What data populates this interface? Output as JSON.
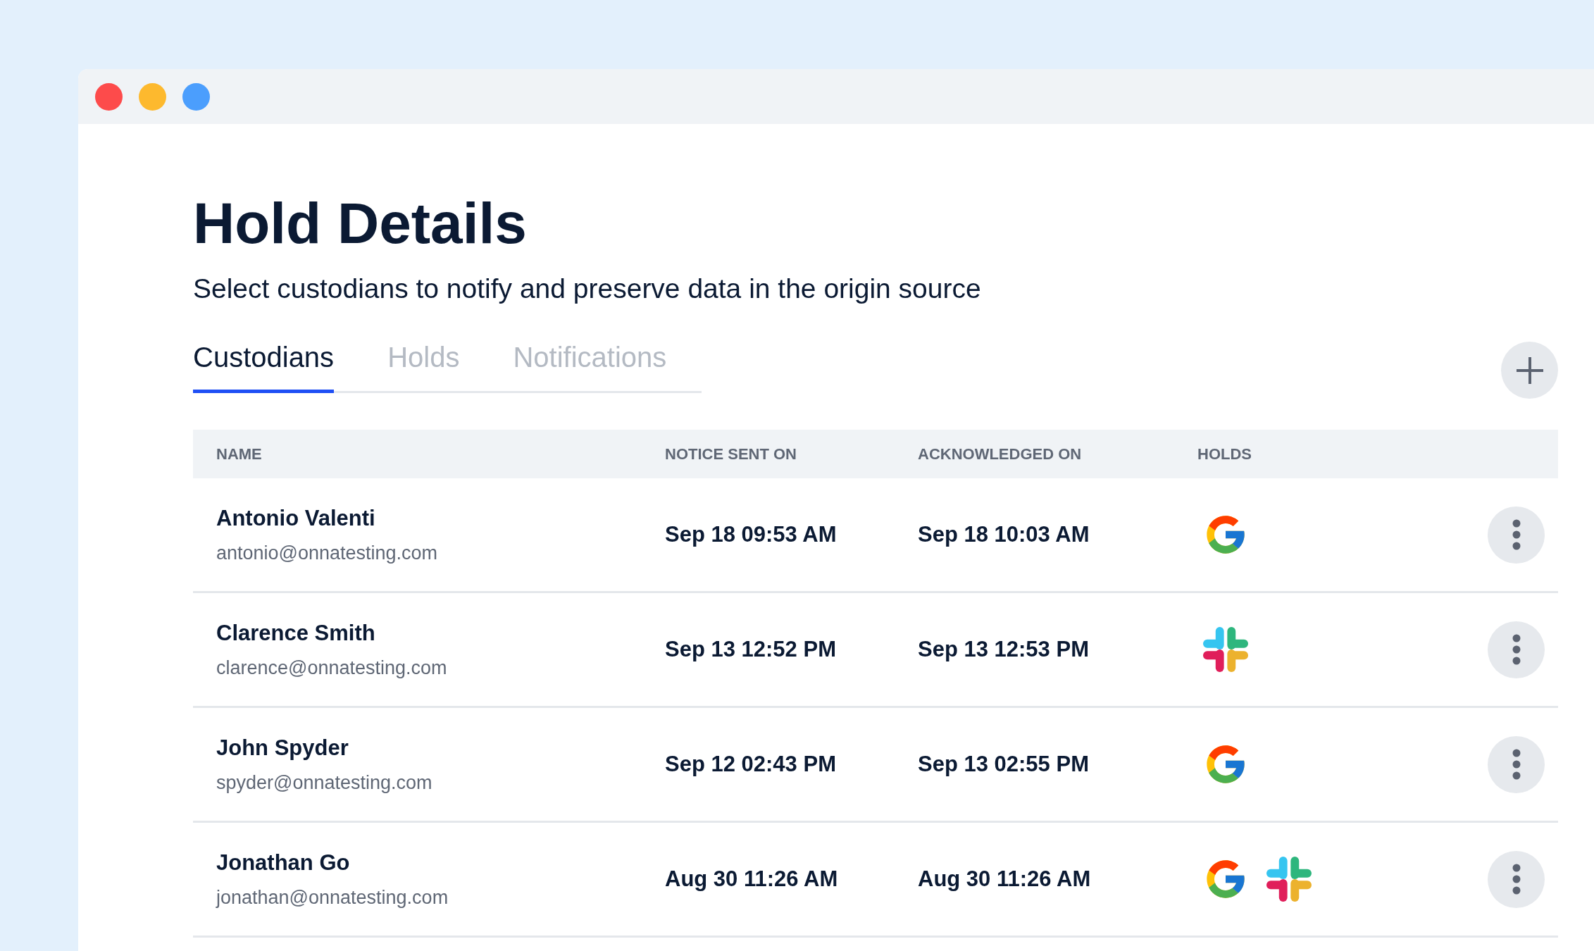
{
  "page": {
    "title": "Hold Details",
    "subtitle": "Select custodians to notify and preserve data in the origin source"
  },
  "tabs": [
    {
      "label": "Custodians",
      "selected": true
    },
    {
      "label": "Holds",
      "selected": false
    },
    {
      "label": "Notifications",
      "selected": false
    }
  ],
  "table": {
    "columns": [
      "NAME",
      "NOTICE SENT ON",
      "ACKNOWLEDGED ON",
      "HOLDS"
    ],
    "rows": [
      {
        "name": "Antonio Valenti",
        "email": "antonio@onnatesting.com",
        "notice_sent_on": "Sep 18 09:53 AM",
        "acknowledged_on": "Sep 18 10:03 AM",
        "holds": [
          {
            "kind": "google"
          }
        ]
      },
      {
        "name": "Clarence Smith",
        "email": "clarence@onnatesting.com",
        "notice_sent_on": "Sep 13 12:52 PM",
        "acknowledged_on": "Sep 13 12:53 PM",
        "holds": [
          {
            "kind": "slack"
          }
        ]
      },
      {
        "name": "John Spyder",
        "email": "spyder@onnatesting.com",
        "notice_sent_on": "Sep 12 02:43 PM",
        "acknowledged_on": "Sep 13 02:55 PM",
        "holds": [
          {
            "kind": "google"
          }
        ]
      },
      {
        "name": "Jonathan Go",
        "email": "jonathan@onnatesting.com",
        "notice_sent_on": "Aug 30 11:26 AM",
        "acknowledged_on": "Aug 30 11:26 AM",
        "holds": [
          {
            "kind": "google"
          },
          {
            "kind": "slack"
          }
        ]
      }
    ]
  }
}
